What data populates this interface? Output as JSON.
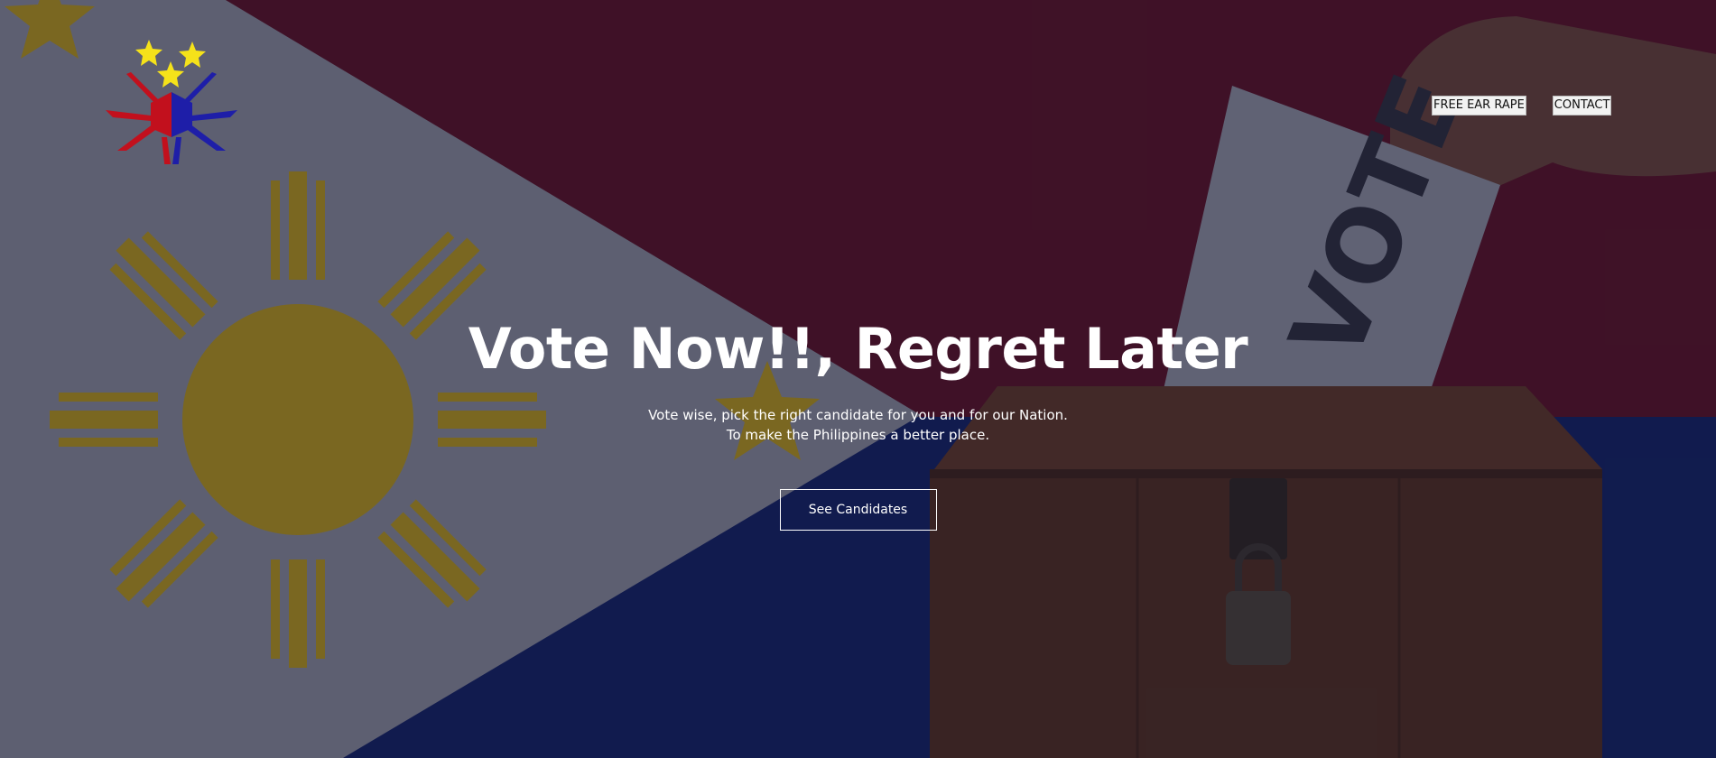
{
  "header": {
    "logo_icon": "philippine-sun-stars-logo",
    "nav": [
      {
        "label": "FREE EAR RAPE"
      },
      {
        "label": "CONTACT"
      }
    ]
  },
  "hero": {
    "title": "Vote Now!!, Regret Later",
    "subtitle_line1": "Vote wise, pick the right candidate for you and for our Nation.",
    "subtitle_line2": "To make the Philippines a better place.",
    "cta_label": "See Candidates",
    "ballot_text": "VOTE"
  },
  "colors": {
    "flag_red": "#5a0f24",
    "flag_blue": "#0f1f63",
    "flag_white": "#8a8d9c",
    "sun_gold": "#b89a1a",
    "box_wood": "#5a3320"
  }
}
